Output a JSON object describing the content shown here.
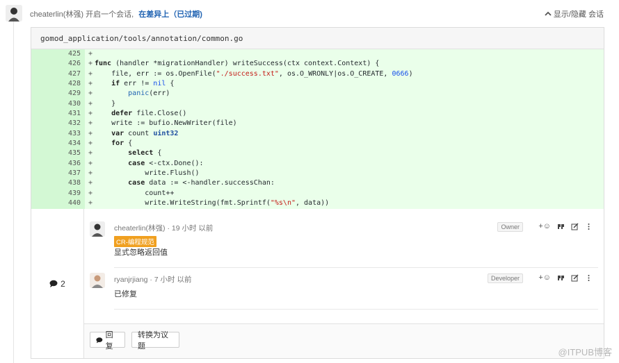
{
  "header": {
    "user": "cheaterlin(林强)",
    "action": "开启一个会话,",
    "link": "在差异上（已过期)",
    "toggle_label": "显示/隐藏 会话"
  },
  "file": {
    "path": "gomod_application/tools/annotation/common.go"
  },
  "code_lines": [
    {
      "num": "425",
      "sign": "+"
    },
    {
      "num": "426",
      "sign": "+"
    },
    {
      "num": "427",
      "sign": "+"
    },
    {
      "num": "428",
      "sign": "+"
    },
    {
      "num": "429",
      "sign": "+"
    },
    {
      "num": "430",
      "sign": "+"
    },
    {
      "num": "431",
      "sign": "+"
    },
    {
      "num": "432",
      "sign": "+"
    },
    {
      "num": "433",
      "sign": "+"
    },
    {
      "num": "434",
      "sign": "+"
    },
    {
      "num": "435",
      "sign": "+"
    },
    {
      "num": "436",
      "sign": "+"
    },
    {
      "num": "437",
      "sign": "+"
    },
    {
      "num": "438",
      "sign": "+"
    },
    {
      "num": "439",
      "sign": "+"
    },
    {
      "num": "440",
      "sign": "+"
    }
  ],
  "code_text": {
    "l426_kw": "func",
    "l426_rest": " (handler *migrationHandler) writeSuccess(ctx context.Context) {",
    "l427_a": "    file, err := os.OpenFile(",
    "l427_str": "\"./success.txt\"",
    "l427_b": ", os.O_WRONLY|os.O_CREATE, ",
    "l427_num": "0666",
    "l427_c": ")",
    "l428_kw": "    if",
    "l428_a": " err != ",
    "l428_nil": "nil",
    "l428_b": " {",
    "l429_fn": "        panic",
    "l429_a": "(err)",
    "l430": "    }",
    "l431_kw": "    defer",
    "l431_a": " file.Close()",
    "l432": "    write := bufio.NewWriter(file)",
    "l433_kw": "    var",
    "l433_a": " count ",
    "l433_ty": "uint32",
    "l434_kw": "    for",
    "l434_a": " {",
    "l435_kw": "        select",
    "l435_a": " {",
    "l436_kw": "        case",
    "l436_a": " <-ctx.Done():",
    "l437": "            write.Flush()",
    "l438_kw": "        case",
    "l438_a": " data := <-handler.successChan:",
    "l439": "            count++",
    "l440_a": "            write.WriteString(fmt.Sprintf(",
    "l440_str": "\"%s\\n\"",
    "l440_b": ", data))"
  },
  "discussion": {
    "comment_count": "2",
    "notes": [
      {
        "author": "cheaterlin(林强)",
        "time": "· 19 小时 以前",
        "role": "Owner",
        "tag": "CR-编程规范",
        "body": "显式忽略返回值",
        "reaction_label": "+☺"
      },
      {
        "author": "ryanjrjiang",
        "time": "· 7 小时 以前",
        "role": "Developer",
        "body": "已修复",
        "reaction_label": "+☺"
      }
    ],
    "reply_label": "回复",
    "convert_label": "转换为议题"
  },
  "watermark": "@ITPUB博客",
  "colors": {
    "added_bg": "#eaffea",
    "added_gutter": "#d3f8d4",
    "link": "#1f62b2",
    "tag_bg": "#f0a020"
  }
}
